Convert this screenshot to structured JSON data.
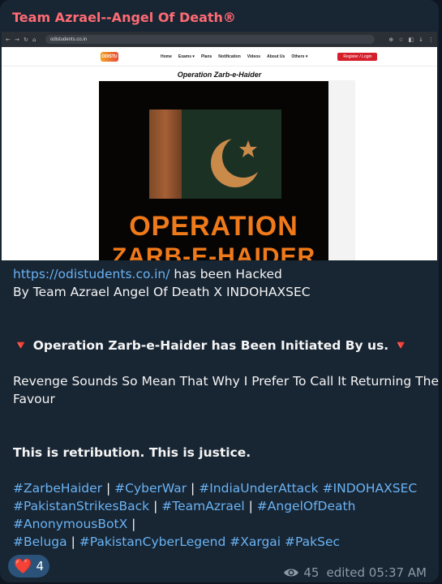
{
  "channel": {
    "name": "Team Azrael--Angel Of Death®"
  },
  "embedded_screenshot": {
    "browser_url": "odistudents.co.in",
    "site_logo": "ODISTU",
    "site_nav": [
      "Home",
      "Exams ▾",
      "Plans",
      "Notification",
      "Videos",
      "About Us",
      "Others ▾"
    ],
    "site_button": "Register / Login",
    "page_heading": "Operation Zarb-e-Haider",
    "poster_line1": "OPERATION",
    "poster_line2": "ZARB-E-HAIDER"
  },
  "message": {
    "link": "https://odistudents.co.in/",
    "hacked_text": " has been Hacked",
    "by_line": " By Team Azrael Angel Of Death X INDOHAXSEC",
    "operation_line": "Operation Zarb-e-Haider has Been Initiated By us.",
    "revenge_line1": "Revenge Sounds So Mean That Why I Prefer To Call It Returning The",
    "revenge_line2": "Favour",
    "justice_line": "This is retribution. This is justice.",
    "hashtags": {
      "zarbehaider": "#ZarbeHaider",
      "cyberwar": "#CyberWar",
      "indiaunderattack": "#IndiaUnderAttack",
      "indohaxsec": "#INDOHAXSEC",
      "pakistanstrikesback": "#PakistanStrikesBack",
      "teamazrael": "#TeamAzrael",
      "angelofdeath": "#AngelOfDeath",
      "anonymousbotx": "#AnonymousBotX",
      "beluga": "#Beluga",
      "pakistancyberlegend": "#PakistanCyberLegend",
      "xargai": "#Xargai",
      "paksec": "#PakSec"
    },
    "separator": "|"
  },
  "reaction": {
    "emoji": "❤️",
    "count": "4"
  },
  "footer": {
    "views": "45",
    "edited_label": "edited 05:37 AM"
  }
}
